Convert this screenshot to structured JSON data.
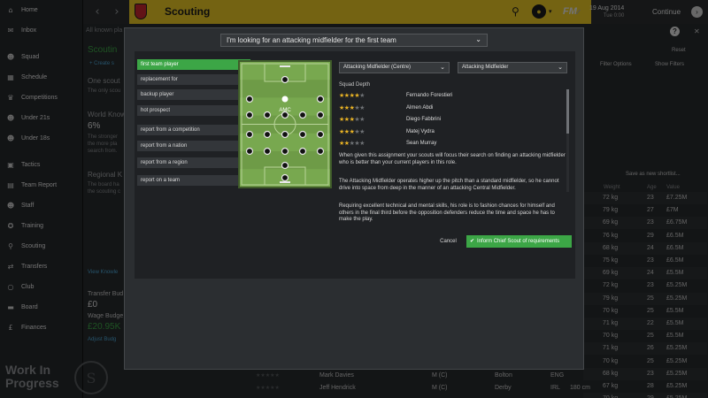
{
  "sidebar": {
    "items": [
      {
        "label": "Home",
        "icon": "home-icon",
        "glyph": "⌂"
      },
      {
        "label": "Inbox",
        "icon": "inbox-icon",
        "glyph": "✉"
      },
      {
        "label": "Squad",
        "icon": "squad-icon",
        "glyph": "☻"
      },
      {
        "label": "Schedule",
        "icon": "schedule-icon",
        "glyph": "▦"
      },
      {
        "label": "Competitions",
        "icon": "trophy-icon",
        "glyph": "♛"
      },
      {
        "label": "Under 21s",
        "icon": "under21-icon",
        "glyph": "☻"
      },
      {
        "label": "Under 18s",
        "icon": "under18-icon",
        "glyph": "☻"
      },
      {
        "label": "Tactics",
        "icon": "tactics-icon",
        "glyph": "▣"
      },
      {
        "label": "Team Report",
        "icon": "team-report-icon",
        "glyph": "▤"
      },
      {
        "label": "Staff",
        "icon": "staff-icon",
        "glyph": "☻"
      },
      {
        "label": "Training",
        "icon": "training-icon",
        "glyph": "✪"
      },
      {
        "label": "Scouting",
        "icon": "scouting-icon",
        "glyph": "⚲"
      },
      {
        "label": "Transfers",
        "icon": "transfers-icon",
        "glyph": "⇄"
      },
      {
        "label": "Club",
        "icon": "club-icon",
        "glyph": "○"
      },
      {
        "label": "Board",
        "icon": "board-icon",
        "glyph": "▬"
      },
      {
        "label": "Finances",
        "icon": "finances-icon",
        "glyph": "£"
      }
    ],
    "watermark_line1": "Work In",
    "watermark_line2": "Progress"
  },
  "topbar": {
    "back_glyph": "‹",
    "forward_glyph": "›",
    "title": "Scouting",
    "search_glyph": "⚲",
    "ball_glyph": "●",
    "caret_glyph": "▾",
    "fm_logo": "FM",
    "fm_version_glyph": "⁄⁄",
    "date": "19 Aug 2014",
    "time": "Tue 0:00",
    "continue_label": "Continue",
    "continue_glyph": "›"
  },
  "background": {
    "all_known_label": "All known pla",
    "scouting_label": "Scoutin",
    "create_label": "+ Create s",
    "one_scout": "One scout",
    "only_scout": "The only scou",
    "world_known": "World Know",
    "pct": "6%",
    "stronger1": "The stronger",
    "stronger2": "the more pla",
    "stronger3": "search from.",
    "regional": "Regional K",
    "board_has": "The board ha",
    "scouting_c": "the scouting c",
    "view_knowledge": "View Knowle",
    "transfer_budget": "Transfer Bud",
    "transfer_value": "£0",
    "wage_budget": "Wage Budge",
    "wage_value": "£20.95K",
    "adjust": "Adjust Budg",
    "help_glyph": "?",
    "close_glyph": "✕",
    "reset_label": "Reset",
    "filter_options": "Filter Options",
    "show_filters": "Show Filters",
    "save_shortlist": "Save as new shortlist...",
    "col_weight": "Weight",
    "col_age": "Age",
    "col_value": "Value",
    "rows": [
      [
        "72 kg",
        "23",
        "£7.25M"
      ],
      [
        "79 kg",
        "27",
        "£7M"
      ],
      [
        "69 kg",
        "23",
        "£6.75M"
      ],
      [
        "76 kg",
        "29",
        "£6.5M"
      ],
      [
        "68 kg",
        "24",
        "£6.5M"
      ],
      [
        "75 kg",
        "23",
        "£6.5M"
      ],
      [
        "69 kg",
        "24",
        "£5.5M"
      ],
      [
        "72 kg",
        "23",
        "£5.25M"
      ],
      [
        "79 kg",
        "25",
        "£5.25M"
      ],
      [
        "70 kg",
        "25",
        "£5.5M"
      ],
      [
        "71 kg",
        "22",
        "£5.5M"
      ],
      [
        "70 kg",
        "25",
        "£5.5M"
      ],
      [
        "71 kg",
        "26",
        "£5.25M"
      ],
      [
        "70 kg",
        "25",
        "£5.25M"
      ],
      [
        "68 kg",
        "23",
        "£5.25M"
      ],
      [
        "67 kg",
        "28",
        "£5.25M"
      ],
      [
        "70 kg",
        "29",
        "£5.25M"
      ]
    ],
    "bottom_rows": [
      {
        "name": "Mark Davies",
        "pos": "M (C)",
        "club": "Bolton",
        "nat": "ENG",
        "height": "",
        "weight": "",
        "age": "",
        "value": ""
      },
      {
        "name": "Jeff Hendrick",
        "pos": "M (C)",
        "club": "Derby",
        "nat": "IRL",
        "height": "180 cm",
        "weight": "",
        "age": "",
        "value": ""
      }
    ]
  },
  "modal": {
    "goal": "I'm looking for an attacking midfielder for the first team",
    "chevron_glyph": "⌄",
    "options": [
      {
        "label": "first team player",
        "active": true
      },
      {
        "label": "replacement for",
        "active": false
      },
      {
        "label": "backup player",
        "active": false
      },
      {
        "label": "hot prospect",
        "active": false
      },
      {
        "label": "report from a competition",
        "active": false
      },
      {
        "label": "report from a nation",
        "active": false
      },
      {
        "label": "report from a region",
        "active": false
      },
      {
        "label": "report on a team",
        "active": false
      }
    ],
    "selected_position": "AMC",
    "position_select": "Attacking Midfielder (Centre)",
    "role_select": "Attacking Midfielder",
    "squad_depth_label": "Squad Depth",
    "squad_depth": [
      {
        "name": "Fernando Forestieri",
        "stars": 3.5
      },
      {
        "name": "Almen Abdi",
        "stars": 3
      },
      {
        "name": "Diego Fabbrini",
        "stars": 2.5
      },
      {
        "name": "Matej Vydra",
        "stars": 2.5
      },
      {
        "name": "Sean Murray",
        "stars": 1.5
      }
    ],
    "paragraphs": [
      "When given this assignment your scouts will focus their search on finding an attacking midfielder who is better than your current players in this role.",
      "The Attacking Midfielder operates higher up the pitch than a standard midfielder, so he cannot drive into space from deep in the manner of an attacking Central Midfielder.",
      "Requiring excellent technical and mental skills, his role is to fashion chances for himself and others in the final third before the opposition defenders reduce the time and space he has to make the play."
    ],
    "cancel_label": "Cancel",
    "confirm_label": "Inform Chief Scout of requirements",
    "confirm_glyph": "✔"
  },
  "colors": {
    "accent_green": "#3ca646",
    "club_yellow": "#e8c625",
    "star_gold": "#e8b224",
    "pitch_green": "#6e9b47"
  }
}
